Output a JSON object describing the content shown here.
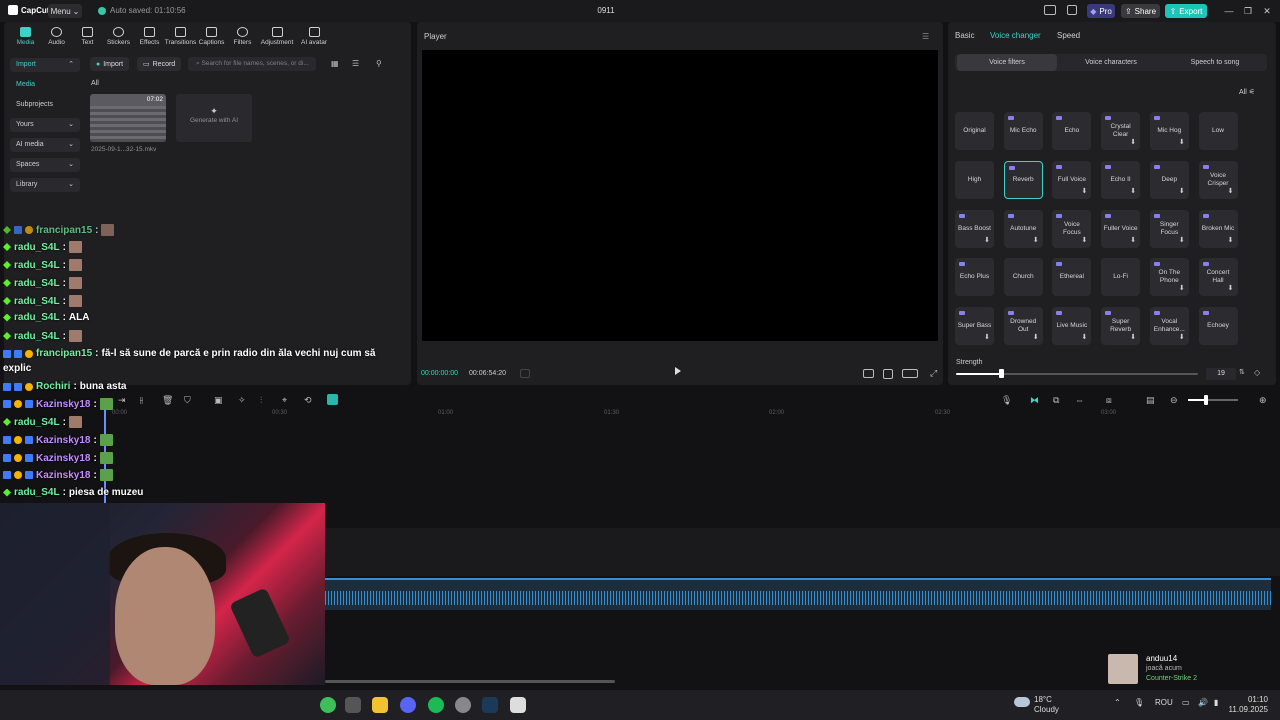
{
  "app": {
    "name": "CapCut",
    "menu_label": "Menu",
    "autosave": "Auto saved: 01:10:56",
    "project_title": "0911",
    "pro_label": "Pro",
    "share_label": "Share",
    "export_label": "Export",
    "colors": {
      "accent": "#3fd1c6",
      "export": "#1fc4b8",
      "pro": "#3a3a7a"
    }
  },
  "toolbar": {
    "items": [
      {
        "label": "Media",
        "icon": "media-icon"
      },
      {
        "label": "Audio",
        "icon": "audio-icon"
      },
      {
        "label": "Text",
        "icon": "text-icon"
      },
      {
        "label": "Stickers",
        "icon": "stickers-icon"
      },
      {
        "label": "Effects",
        "icon": "effects-icon"
      },
      {
        "label": "Transitions",
        "icon": "transitions-icon"
      },
      {
        "label": "Captions",
        "icon": "captions-icon"
      },
      {
        "label": "Filters",
        "icon": "filters-icon"
      },
      {
        "label": "Adjustment",
        "icon": "adjustment-icon"
      },
      {
        "label": "AI avatar",
        "icon": "ai-avatar-icon"
      }
    ]
  },
  "sidebar": {
    "items": [
      {
        "label": "Import"
      },
      {
        "label": "Media"
      },
      {
        "label": "Subprojects"
      },
      {
        "label": "Yours"
      },
      {
        "label": "AI media"
      },
      {
        "label": "Spaces"
      },
      {
        "label": "Library"
      }
    ]
  },
  "media": {
    "import_label": "Import",
    "record_label": "Record",
    "search_placeholder": "Search for file names, scenes, or di...",
    "filter_all": "All",
    "clip": {
      "duration": "07:02",
      "name": "2025-09-1...32-15.mkv"
    },
    "generate_label": "Generate with AI"
  },
  "player": {
    "label": "Player",
    "current_time": "00:00:00:00",
    "total_time": "00:06:54:20"
  },
  "right_panel": {
    "tabs": [
      "Basic",
      "Voice changer",
      "Speed"
    ],
    "subtabs": [
      "Voice filters",
      "Voice characters",
      "Speech to song"
    ],
    "all_label": "All",
    "filters": [
      "Original",
      "Mic Echo",
      "Echo",
      "Crystal Clear",
      "Mic Hog",
      "Low",
      "High",
      "Reverb",
      "Full Voice",
      "Echo II",
      "Deep",
      "Voice Crisper",
      "Bass Boost",
      "Autotune",
      "Voice Focus",
      "Fuller Voice",
      "Singer Focus",
      "Broken Mic",
      "Echo Plus",
      "Church",
      "Ethereal",
      "Lo-Fi",
      "On The Phone",
      "Concert Hall",
      "Super Bass",
      "Drowned Out",
      "Live Music",
      "Super Reverb",
      "Vocal Enhance...",
      "Echoey"
    ],
    "selected_filter": "Reverb",
    "strength_label": "Strength",
    "strength_value": "19"
  },
  "timeline": {
    "ruler_labels": [
      "00:00",
      "00:30",
      "01:00",
      "01:30",
      "02:00",
      "02:30",
      "03:00"
    ]
  },
  "chat": {
    "messages": [
      {
        "user": "francipan15",
        "text": ""
      },
      {
        "user": "radu_S4L",
        "text": ""
      },
      {
        "user": "radu_S4L",
        "text": ""
      },
      {
        "user": "radu_S4L",
        "text": ""
      },
      {
        "user": "radu_S4L",
        "text": ""
      },
      {
        "user": "radu_S4L",
        "text": "ALA"
      },
      {
        "user": "radu_S4L",
        "text": ""
      },
      {
        "user": "francipan15",
        "text": "fă-l să sune de parcă e prin radio din ăla vechi nuj cum să"
      },
      {
        "user": "",
        "text": "explic"
      },
      {
        "user": "Rochiri",
        "text": "buna asta"
      },
      {
        "user": "Kazinsky18",
        "text": ""
      },
      {
        "user": "radu_S4L",
        "text": ""
      },
      {
        "user": "Kazinsky18",
        "text": ""
      },
      {
        "user": "Kazinsky18",
        "text": ""
      },
      {
        "user": "Kazinsky18",
        "text": ""
      },
      {
        "user": "radu_S4L",
        "text": "piesa de muzeu"
      }
    ]
  },
  "notification": {
    "user": "anduu14",
    "status": "joacă acum",
    "game": "Counter-Strike 2"
  },
  "taskbar": {
    "weather_temp": "18°C",
    "weather_desc": "Cloudy",
    "lang": "ROU",
    "time": "01:10",
    "date": "11.09.2025"
  }
}
